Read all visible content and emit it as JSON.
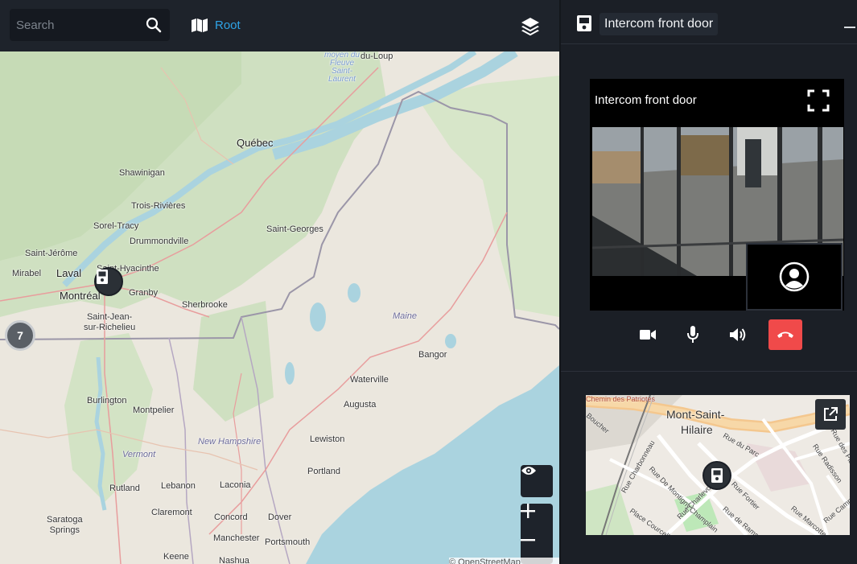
{
  "search": {
    "placeholder": "Search",
    "value": ""
  },
  "nav": {
    "root_label": "Root"
  },
  "map": {
    "cluster_count": "7",
    "attribution": "© OpenStreetMap",
    "labels": {
      "quebec": "Québec",
      "shawinigan": "Shawinigan",
      "trois_rivieres": "Trois-Rivières",
      "sorel": "Sorel-Tracy",
      "drummondville": "Drummondville",
      "saint_jerome": "Saint-Jérôme",
      "laval": "Laval",
      "mirabel": "Mirabel",
      "saint_hyacinthe": "Saint-Hyacinthe",
      "granby": "Granby",
      "montreal": "Montréal",
      "sherbrooke": "Sherbrooke",
      "saint_jean": "Saint-Jean-\nsur-Richelieu",
      "saint_georges": "Saint-Georges",
      "du_loup": "du-Loup",
      "moyen": "moyen du Fleuve Saint-Laurent",
      "maine": "Maine",
      "bangor": "Bangor",
      "waterville": "Waterville",
      "augusta": "Augusta",
      "lewiston": "Lewiston",
      "portland": "Portland",
      "burlington": "Burlington",
      "montpelier": "Montpelier",
      "vermont": "Vermont",
      "new_hampshire": "New Hampshire",
      "rutland": "Rutland",
      "lebanon": "Lebanon",
      "laconia": "Laconia",
      "claremont": "Claremont",
      "concord": "Concord",
      "dover": "Dover",
      "saratoga": "Saratoga\nSprings",
      "manchester": "Manchester",
      "portsmouth": "Portsmouth",
      "keene": "Keene",
      "nashua": "Nashua"
    }
  },
  "panel": {
    "title": "Intercom front door",
    "video_title": "Intercom front door"
  },
  "minimap": {
    "labels": {
      "patriotes": "Chemin des Patriotes",
      "city_line1": "Mont-Saint-",
      "city_line2": "Hilaire",
      "rue_du_parc": "Rue du Parc",
      "bourcher": "Boucher",
      "charbonneau": "Rue Charbonneau",
      "montigny": "Rue De Montigny",
      "charlevoix": "Rue Charlevoix",
      "fortier": "Rue Fortier",
      "ramsay": "Rue de Ramsay",
      "place_courcelle": "Place Courcelle",
      "champlain": "Champlain",
      "radisson": "Rue Radisson",
      "campbell": "Rue Campbell",
      "marcotte": "Rue Marcotte",
      "rue_des_plat": "Rue des Plat"
    }
  },
  "colors": {
    "accent": "#2ea3e6",
    "hangup": "#f04a4a",
    "bg": "#1b1f26"
  }
}
